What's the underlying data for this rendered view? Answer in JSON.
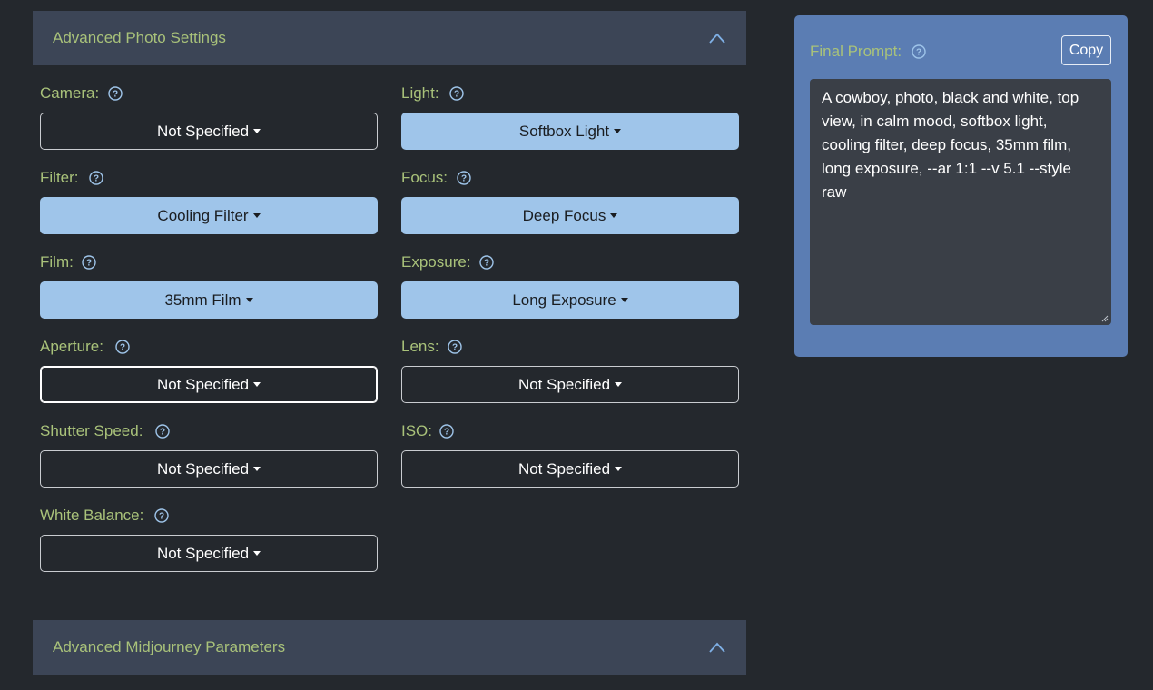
{
  "photo_settings": {
    "header_title": "Advanced Photo Settings",
    "fields": {
      "camera": {
        "label": "Camera:",
        "value": "Not Specified"
      },
      "light": {
        "label": "Light:",
        "value": "Softbox Light"
      },
      "filter": {
        "label": "Filter:",
        "value": "Cooling Filter"
      },
      "focus": {
        "label": "Focus:",
        "value": "Deep Focus"
      },
      "film": {
        "label": "Film:",
        "value": "35mm Film"
      },
      "exposure": {
        "label": "Exposure:",
        "value": "Long Exposure"
      },
      "aperture": {
        "label": "Aperture:",
        "value": "Not Specified"
      },
      "lens": {
        "label": "Lens:",
        "value": "Not Specified"
      },
      "shutter_speed": {
        "label": "Shutter Speed:",
        "value": "Not Specified"
      },
      "iso": {
        "label": "ISO:",
        "value": "Not Specified"
      },
      "white_balance": {
        "label": "White Balance:",
        "value": "Not Specified"
      }
    }
  },
  "midjourney_params": {
    "header_title": "Advanced Midjourney Parameters"
  },
  "final_prompt": {
    "label": "Final Prompt:",
    "copy_label": "Copy",
    "text": "A cowboy, photo, black and white, top view, in calm mood, softbox light, cooling filter, deep focus, 35mm film, long exposure, --ar 1:1 --v 5.1 --style raw"
  },
  "colors": {
    "background": "#24282d",
    "accordion_header": "#3c4556",
    "label_text": "#a9c27a",
    "selected_dropdown": "#9fc5ea",
    "prompt_panel": "#5b7db3",
    "prompt_textarea": "#3a3f47"
  }
}
